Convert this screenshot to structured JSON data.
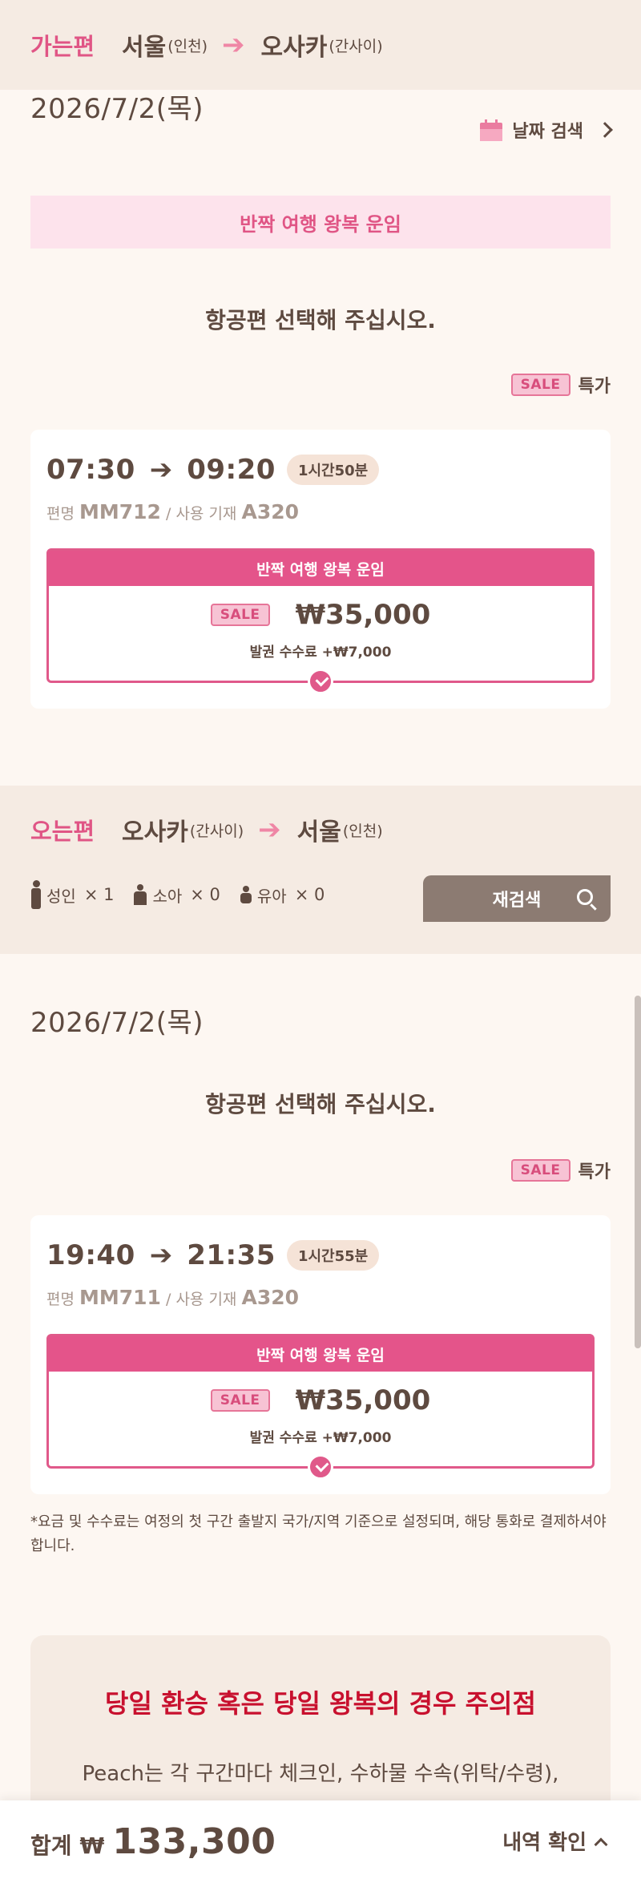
{
  "outbound": {
    "leg_label": "가는편",
    "origin_city": "서울",
    "origin_airport": "(인천)",
    "dest_city": "오사카",
    "dest_airport": "(간사이)",
    "date": "2026/7/2(목)",
    "date_search_label": "날짜 검색",
    "fare_banner": "반짝 여행 왕복 운임",
    "prompt": "항공편 선택해 주십시오.",
    "legend_sale": "SALE",
    "legend_label": "특가",
    "flight": {
      "depart": "07:30",
      "arrive": "09:20",
      "duration": "1시간50분",
      "flight_no_label": "편명",
      "flight_no": "MM712",
      "aircraft_label": "/ 사용 기재",
      "aircraft": "A320",
      "fare_name": "반짝 여행 왕복 운임",
      "sale_tag": "SALE",
      "price": "₩35,000",
      "fee": "발권 수수료 +₩7,000"
    }
  },
  "inbound": {
    "leg_label": "오는편",
    "origin_city": "오사카",
    "origin_airport": "(간사이)",
    "dest_city": "서울",
    "dest_airport": "(인천)",
    "passengers": [
      {
        "label": "성인",
        "count": "× 1"
      },
      {
        "label": "소아",
        "count": "× 0"
      },
      {
        "label": "유아",
        "count": "× 0"
      }
    ],
    "research_label": "재검색",
    "date": "2026/7/2(목)",
    "prompt": "항공편 선택해 주십시오.",
    "legend_sale": "SALE",
    "legend_label": "특가",
    "flight": {
      "depart": "19:40",
      "arrive": "21:35",
      "duration": "1시간55분",
      "flight_no_label": "편명",
      "flight_no": "MM711",
      "aircraft_label": "/ 사용 기재",
      "aircraft": "A320",
      "fare_name": "반짝 여행 왕복 운임",
      "sale_tag": "SALE",
      "price": "₩35,000",
      "fee": "발권 수수료 +₩7,000"
    }
  },
  "note": "*요금 및 수수료는 여정의 첫 구간 출발지 국가/지역 기준으로 설정되며, 해당 통화로 결제하셔야 합니다.",
  "caution": {
    "title": "당일 환승 혹은 당일 왕복의 경우 주의점",
    "text": "Peach는 각 구간마다 체크인, 수하물 수속(위탁/수령),"
  },
  "footer": {
    "total_label": "합계",
    "currency": "₩",
    "total_amount": "133,300",
    "details_label": "내역 확인"
  },
  "colors": {
    "accent_pink": "#e0598a",
    "caution_red": "#c8102e",
    "text_brown": "#5e4a40",
    "bg_cream": "#fdf7f2",
    "bar_beige": "#f5ebe3"
  }
}
